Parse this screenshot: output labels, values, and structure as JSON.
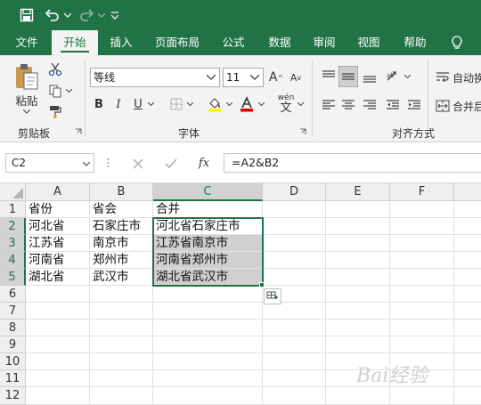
{
  "colors": {
    "brand": "#217346",
    "selection": "#217346",
    "highlight": "#d0d0d0"
  },
  "qat": {
    "save_icon": "save-icon",
    "undo_icon": "undo-icon",
    "redo_icon": "redo-icon",
    "customize_icon": "customize-qat-icon"
  },
  "tabs": [
    {
      "label": "文件",
      "active": false
    },
    {
      "label": "开始",
      "active": true
    },
    {
      "label": "插入",
      "active": false
    },
    {
      "label": "页面布局",
      "active": false
    },
    {
      "label": "公式",
      "active": false
    },
    {
      "label": "数据",
      "active": false
    },
    {
      "label": "审阅",
      "active": false
    },
    {
      "label": "视图",
      "active": false
    },
    {
      "label": "帮助",
      "active": false
    }
  ],
  "ribbon": {
    "clipboard": {
      "paste_label": "粘贴",
      "group_label": "剪贴板"
    },
    "font": {
      "font_name": "等线",
      "font_size": "11",
      "group_label": "字体",
      "bold": "B",
      "italic": "I",
      "underline": "U",
      "grow": "A",
      "shrink": "A",
      "phonetic": "wén"
    },
    "alignment": {
      "wrap_label": "自动换",
      "merge_label": "合并后",
      "group_label": "对齐方式"
    }
  },
  "formula_bar": {
    "name_box": "C2",
    "fx": "fx",
    "formula": "=A2&B2"
  },
  "columns": [
    "A",
    "B",
    "C",
    "D",
    "E",
    "F"
  ],
  "rows": [
    "1",
    "2",
    "3",
    "4",
    "5",
    "6",
    "7",
    "8",
    "9",
    "10",
    "11",
    "12"
  ],
  "cells": [
    [
      "省份",
      "省会",
      "合并"
    ],
    [
      "河北省",
      "石家庄市",
      "河北省石家庄市"
    ],
    [
      "江苏省",
      "南京市",
      "江苏省南京市"
    ],
    [
      "河南省",
      "郑州市",
      "河南省郑州市"
    ],
    [
      "湖北省",
      "武汉市",
      "湖北省武汉市"
    ]
  ],
  "watermark": "Bai经验"
}
